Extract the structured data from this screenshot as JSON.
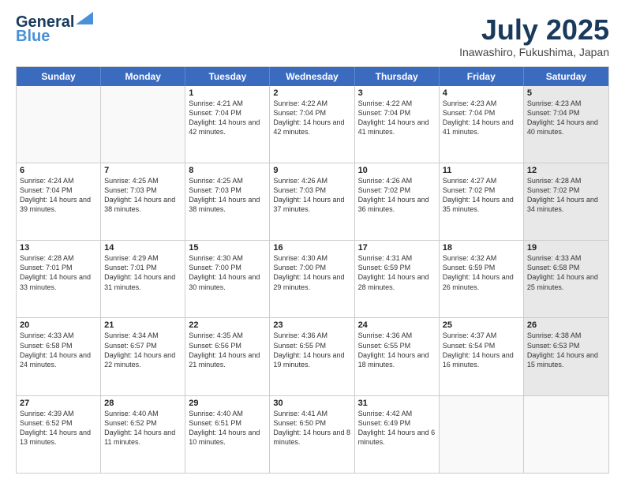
{
  "header": {
    "logo_line1": "General",
    "logo_line2": "Blue",
    "month": "July 2025",
    "location": "Inawashiro, Fukushima, Japan"
  },
  "weekdays": [
    "Sunday",
    "Monday",
    "Tuesday",
    "Wednesday",
    "Thursday",
    "Friday",
    "Saturday"
  ],
  "weeks": [
    [
      {
        "day": "",
        "sunrise": "",
        "sunset": "",
        "daylight": "",
        "shaded": false,
        "empty": true
      },
      {
        "day": "",
        "sunrise": "",
        "sunset": "",
        "daylight": "",
        "shaded": false,
        "empty": true
      },
      {
        "day": "1",
        "sunrise": "Sunrise: 4:21 AM",
        "sunset": "Sunset: 7:04 PM",
        "daylight": "Daylight: 14 hours and 42 minutes.",
        "shaded": false,
        "empty": false
      },
      {
        "day": "2",
        "sunrise": "Sunrise: 4:22 AM",
        "sunset": "Sunset: 7:04 PM",
        "daylight": "Daylight: 14 hours and 42 minutes.",
        "shaded": false,
        "empty": false
      },
      {
        "day": "3",
        "sunrise": "Sunrise: 4:22 AM",
        "sunset": "Sunset: 7:04 PM",
        "daylight": "Daylight: 14 hours and 41 minutes.",
        "shaded": false,
        "empty": false
      },
      {
        "day": "4",
        "sunrise": "Sunrise: 4:23 AM",
        "sunset": "Sunset: 7:04 PM",
        "daylight": "Daylight: 14 hours and 41 minutes.",
        "shaded": false,
        "empty": false
      },
      {
        "day": "5",
        "sunrise": "Sunrise: 4:23 AM",
        "sunset": "Sunset: 7:04 PM",
        "daylight": "Daylight: 14 hours and 40 minutes.",
        "shaded": true,
        "empty": false
      }
    ],
    [
      {
        "day": "6",
        "sunrise": "Sunrise: 4:24 AM",
        "sunset": "Sunset: 7:04 PM",
        "daylight": "Daylight: 14 hours and 39 minutes.",
        "shaded": false,
        "empty": false
      },
      {
        "day": "7",
        "sunrise": "Sunrise: 4:25 AM",
        "sunset": "Sunset: 7:03 PM",
        "daylight": "Daylight: 14 hours and 38 minutes.",
        "shaded": false,
        "empty": false
      },
      {
        "day": "8",
        "sunrise": "Sunrise: 4:25 AM",
        "sunset": "Sunset: 7:03 PM",
        "daylight": "Daylight: 14 hours and 38 minutes.",
        "shaded": false,
        "empty": false
      },
      {
        "day": "9",
        "sunrise": "Sunrise: 4:26 AM",
        "sunset": "Sunset: 7:03 PM",
        "daylight": "Daylight: 14 hours and 37 minutes.",
        "shaded": false,
        "empty": false
      },
      {
        "day": "10",
        "sunrise": "Sunrise: 4:26 AM",
        "sunset": "Sunset: 7:02 PM",
        "daylight": "Daylight: 14 hours and 36 minutes.",
        "shaded": false,
        "empty": false
      },
      {
        "day": "11",
        "sunrise": "Sunrise: 4:27 AM",
        "sunset": "Sunset: 7:02 PM",
        "daylight": "Daylight: 14 hours and 35 minutes.",
        "shaded": false,
        "empty": false
      },
      {
        "day": "12",
        "sunrise": "Sunrise: 4:28 AM",
        "sunset": "Sunset: 7:02 PM",
        "daylight": "Daylight: 14 hours and 34 minutes.",
        "shaded": true,
        "empty": false
      }
    ],
    [
      {
        "day": "13",
        "sunrise": "Sunrise: 4:28 AM",
        "sunset": "Sunset: 7:01 PM",
        "daylight": "Daylight: 14 hours and 33 minutes.",
        "shaded": false,
        "empty": false
      },
      {
        "day": "14",
        "sunrise": "Sunrise: 4:29 AM",
        "sunset": "Sunset: 7:01 PM",
        "daylight": "Daylight: 14 hours and 31 minutes.",
        "shaded": false,
        "empty": false
      },
      {
        "day": "15",
        "sunrise": "Sunrise: 4:30 AM",
        "sunset": "Sunset: 7:00 PM",
        "daylight": "Daylight: 14 hours and 30 minutes.",
        "shaded": false,
        "empty": false
      },
      {
        "day": "16",
        "sunrise": "Sunrise: 4:30 AM",
        "sunset": "Sunset: 7:00 PM",
        "daylight": "Daylight: 14 hours and 29 minutes.",
        "shaded": false,
        "empty": false
      },
      {
        "day": "17",
        "sunrise": "Sunrise: 4:31 AM",
        "sunset": "Sunset: 6:59 PM",
        "daylight": "Daylight: 14 hours and 28 minutes.",
        "shaded": false,
        "empty": false
      },
      {
        "day": "18",
        "sunrise": "Sunrise: 4:32 AM",
        "sunset": "Sunset: 6:59 PM",
        "daylight": "Daylight: 14 hours and 26 minutes.",
        "shaded": false,
        "empty": false
      },
      {
        "day": "19",
        "sunrise": "Sunrise: 4:33 AM",
        "sunset": "Sunset: 6:58 PM",
        "daylight": "Daylight: 14 hours and 25 minutes.",
        "shaded": true,
        "empty": false
      }
    ],
    [
      {
        "day": "20",
        "sunrise": "Sunrise: 4:33 AM",
        "sunset": "Sunset: 6:58 PM",
        "daylight": "Daylight: 14 hours and 24 minutes.",
        "shaded": false,
        "empty": false
      },
      {
        "day": "21",
        "sunrise": "Sunrise: 4:34 AM",
        "sunset": "Sunset: 6:57 PM",
        "daylight": "Daylight: 14 hours and 22 minutes.",
        "shaded": false,
        "empty": false
      },
      {
        "day": "22",
        "sunrise": "Sunrise: 4:35 AM",
        "sunset": "Sunset: 6:56 PM",
        "daylight": "Daylight: 14 hours and 21 minutes.",
        "shaded": false,
        "empty": false
      },
      {
        "day": "23",
        "sunrise": "Sunrise: 4:36 AM",
        "sunset": "Sunset: 6:55 PM",
        "daylight": "Daylight: 14 hours and 19 minutes.",
        "shaded": false,
        "empty": false
      },
      {
        "day": "24",
        "sunrise": "Sunrise: 4:36 AM",
        "sunset": "Sunset: 6:55 PM",
        "daylight": "Daylight: 14 hours and 18 minutes.",
        "shaded": false,
        "empty": false
      },
      {
        "day": "25",
        "sunrise": "Sunrise: 4:37 AM",
        "sunset": "Sunset: 6:54 PM",
        "daylight": "Daylight: 14 hours and 16 minutes.",
        "shaded": false,
        "empty": false
      },
      {
        "day": "26",
        "sunrise": "Sunrise: 4:38 AM",
        "sunset": "Sunset: 6:53 PM",
        "daylight": "Daylight: 14 hours and 15 minutes.",
        "shaded": true,
        "empty": false
      }
    ],
    [
      {
        "day": "27",
        "sunrise": "Sunrise: 4:39 AM",
        "sunset": "Sunset: 6:52 PM",
        "daylight": "Daylight: 14 hours and 13 minutes.",
        "shaded": false,
        "empty": false
      },
      {
        "day": "28",
        "sunrise": "Sunrise: 4:40 AM",
        "sunset": "Sunset: 6:52 PM",
        "daylight": "Daylight: 14 hours and 11 minutes.",
        "shaded": false,
        "empty": false
      },
      {
        "day": "29",
        "sunrise": "Sunrise: 4:40 AM",
        "sunset": "Sunset: 6:51 PM",
        "daylight": "Daylight: 14 hours and 10 minutes.",
        "shaded": false,
        "empty": false
      },
      {
        "day": "30",
        "sunrise": "Sunrise: 4:41 AM",
        "sunset": "Sunset: 6:50 PM",
        "daylight": "Daylight: 14 hours and 8 minutes.",
        "shaded": false,
        "empty": false
      },
      {
        "day": "31",
        "sunrise": "Sunrise: 4:42 AM",
        "sunset": "Sunset: 6:49 PM",
        "daylight": "Daylight: 14 hours and 6 minutes.",
        "shaded": false,
        "empty": false
      },
      {
        "day": "",
        "sunrise": "",
        "sunset": "",
        "daylight": "",
        "shaded": false,
        "empty": true
      },
      {
        "day": "",
        "sunrise": "",
        "sunset": "",
        "daylight": "",
        "shaded": true,
        "empty": true
      }
    ]
  ]
}
